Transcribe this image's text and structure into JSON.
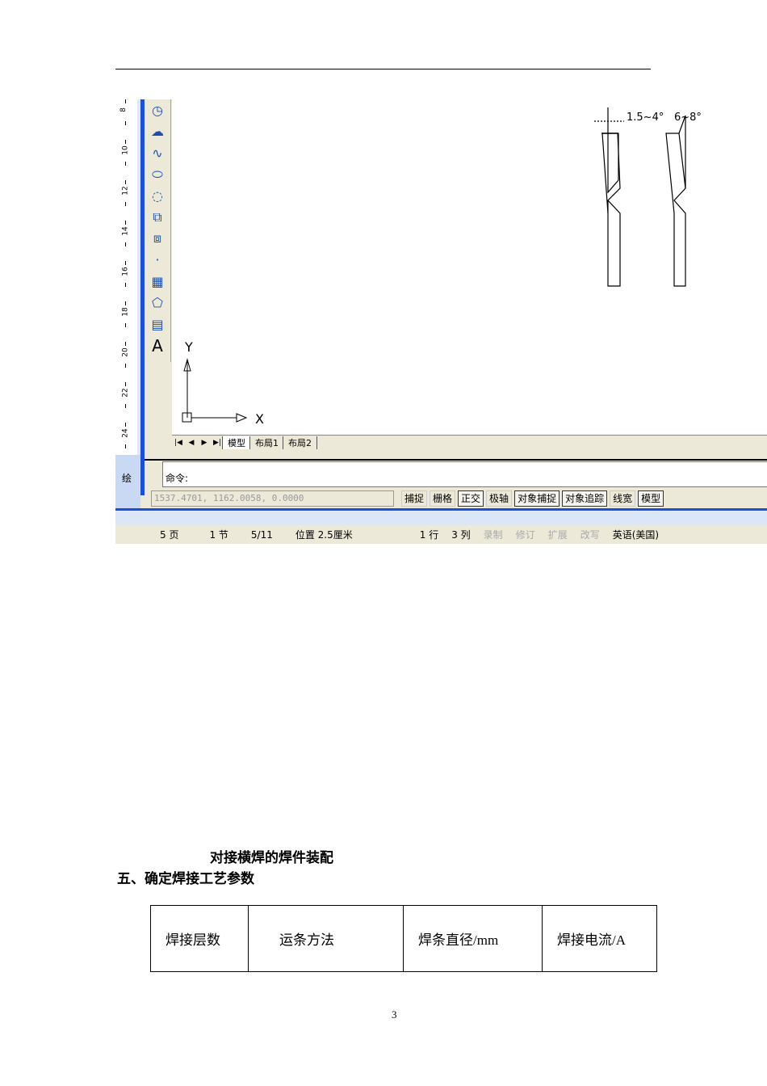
{
  "screenshot": {
    "ruler_numbers": [
      "8",
      "10",
      "12",
      "14",
      "16",
      "18",
      "20",
      "22",
      "24"
    ],
    "toolbar_icons": [
      "arc-icon",
      "revision-cloud-icon",
      "spline-icon",
      "ellipse-icon",
      "ellipse-arc-icon",
      "insert-block-icon",
      "make-block-icon",
      "point-icon",
      "hatch-icon",
      "region-icon",
      "table-icon",
      "multiline-text-icon"
    ],
    "text_tool_glyph": "A",
    "drawing": {
      "dim1": "1.5~4°",
      "dim2": "6~8°",
      "axis_x": "X",
      "axis_y": "Y"
    },
    "tabs": [
      "模型",
      "布局1",
      "布局2"
    ],
    "command_prompt": "命令:",
    "coordinates": "1537.4701, 1162.0058, 0.0000",
    "status_buttons": [
      {
        "label": "捕捉",
        "on": false
      },
      {
        "label": "栅格",
        "on": false
      },
      {
        "label": "正交",
        "on": true
      },
      {
        "label": "极轴",
        "on": false
      },
      {
        "label": "对象捕捉",
        "on": true
      },
      {
        "label": "对象追踪",
        "on": true
      },
      {
        "label": "线宽",
        "on": false
      },
      {
        "label": "模型",
        "on": true
      }
    ],
    "left_panel_label": "绘",
    "word_status": {
      "page": "5 页",
      "section": "1 节",
      "pages": "5/11",
      "position": "位置 2.5厘米",
      "line": "1 行",
      "col": "3 列",
      "rec": "录制",
      "trk": "修订",
      "ext": "扩展",
      "ovr": "改写",
      "lang": "英语(美国)"
    }
  },
  "caption": "对接横焊的焊件装配",
  "section_title": "五、确定焊接工艺参数",
  "table": {
    "headers": [
      "焊接层数",
      "运条方法",
      "焊条直径/mm",
      "焊接电流/A"
    ]
  },
  "page_number": "3"
}
